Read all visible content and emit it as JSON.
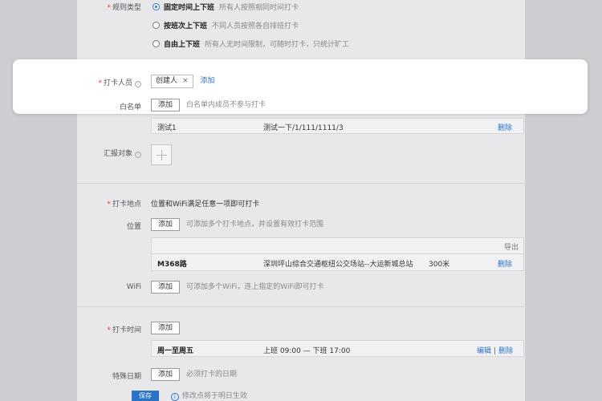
{
  "rule_type": {
    "label": "规则类型",
    "options": [
      {
        "label": "固定时间上下班",
        "hint": "所有人按照相同时间打卡",
        "selected": true
      },
      {
        "label": "按班次上下班",
        "hint": "不同人员按照各自排班打卡",
        "selected": false
      },
      {
        "label": "自由上下班",
        "hint": "所有人无时间限制，可随时打卡，只统计旷工",
        "selected": false
      }
    ]
  },
  "punch_people": {
    "label": "打卡人员",
    "tag": "创建人",
    "tag_remove": "×",
    "add_link": "添加"
  },
  "whitelist": {
    "label": "白名单",
    "add_button": "添加",
    "hint": "白名单内成员不参与打卡",
    "rows": [
      {
        "name": "测试1",
        "path": "测试一下/1/111/1111/3",
        "action": "删除"
      }
    ]
  },
  "report_to": {
    "label": "汇报对象"
  },
  "location": {
    "label": "打卡地点",
    "desc": "位置和WiFi满足任意一项即可打卡",
    "position_label": "位置",
    "add_button": "添加",
    "position_hint": "可添加多个打卡地点，并设置有效打卡范围",
    "export_label": "导出",
    "rows": [
      {
        "name": "M368路",
        "address": "深圳坪山综合交通枢纽公交场站--大运新城总站",
        "range": "300米",
        "action": "删除"
      }
    ],
    "wifi_label": "WiFi",
    "wifi_add_button": "添加",
    "wifi_hint": "可添加多个WiFi，连上指定的WiFi即可打卡"
  },
  "punch_time": {
    "label": "打卡时间",
    "add_button": "添加",
    "rows": [
      {
        "days": "周一至周五",
        "time": "上班 09:00 — 下班 17:00",
        "edit": "编辑",
        "sep": "|",
        "delete": "删除"
      }
    ]
  },
  "special_date": {
    "label": "特殊日期",
    "add_button": "添加",
    "hint": "必须打卡的日期"
  },
  "footer": {
    "save_button": "保存",
    "info_icon": "i",
    "note": "修改点将于明日生效"
  },
  "colors": {
    "accent": "#2b73c8",
    "required": "#e64340",
    "background": "#cdced1"
  }
}
